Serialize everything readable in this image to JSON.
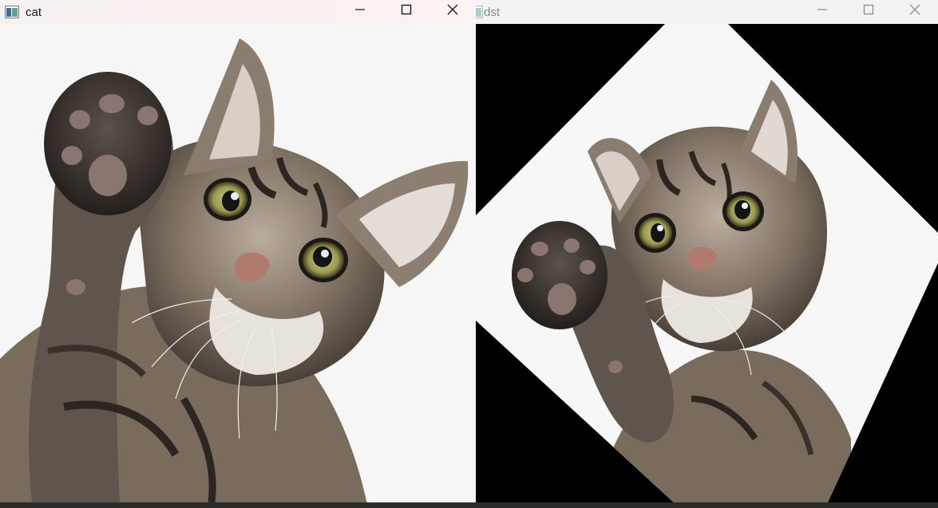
{
  "windows": {
    "cat": {
      "title": "cat",
      "icon": "opencv-window-icon",
      "controls": [
        "minimize-icon",
        "maximize-icon",
        "close-icon"
      ]
    },
    "dst": {
      "title": "dst",
      "icon": "opencv-window-icon",
      "controls": [
        "minimize-icon",
        "maximize-icon",
        "close-icon"
      ]
    }
  },
  "colors": {
    "cat_background": "#f6f6f6",
    "dst_background": "#000000",
    "fur": "#6e6256",
    "eye": "#a8a660"
  }
}
